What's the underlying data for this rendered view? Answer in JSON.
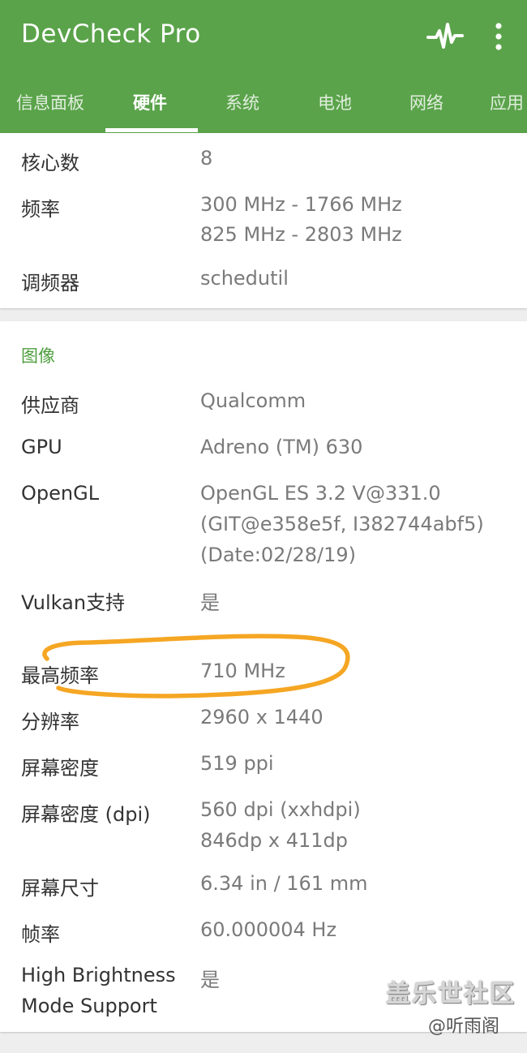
{
  "header": {
    "app_title": "DevCheck Pro",
    "pulse_icon": "pulse-icon",
    "menu_icon": "more-vert-icon",
    "colors": {
      "bar": "#5aa34a",
      "accent": "#4e9e3e"
    }
  },
  "tabs": [
    {
      "label": "信息面板"
    },
    {
      "label": "硬件"
    },
    {
      "label": "系统"
    },
    {
      "label": "电池"
    },
    {
      "label": "网络"
    },
    {
      "label": "应用"
    }
  ],
  "active_tab": "硬件",
  "cpu": {
    "cores_label": "核心数",
    "cores_value": "8",
    "freq_label": "频率",
    "freq_values": [
      "300 MHz - 1766 MHz",
      "825 MHz - 2803 MHz"
    ],
    "governor_label": "调频器",
    "governor_value": "schedutil"
  },
  "graphics": {
    "title": "图像",
    "rows": [
      {
        "label": "供应商",
        "lines": [
          "Qualcomm"
        ]
      },
      {
        "label": "GPU",
        "lines": [
          "Adreno (TM) 630"
        ]
      },
      {
        "label": "OpenGL",
        "lines": [
          "OpenGL ES 3.2 V@331.0",
          "(GIT@e358e5f, I382744abf5)",
          "(Date:02/28/19)"
        ]
      },
      {
        "label": "Vulkan支持",
        "lines": [
          "是"
        ]
      },
      {
        "label": "最高频率",
        "lines": [
          "710 MHz"
        ]
      },
      {
        "label": "分辨率",
        "lines": [
          "2960 x 1440"
        ]
      },
      {
        "label": "屏幕密度",
        "lines": [
          "519 ppi"
        ]
      },
      {
        "label": "屏幕密度 (dpi)",
        "lines": [
          "560 dpi (xxhdpi)",
          "846dp x 411dp"
        ]
      },
      {
        "label": "屏幕尺寸",
        "lines": [
          "6.34 in / 161 mm"
        ]
      },
      {
        "label": "帧率",
        "lines": [
          "60.000004 Hz"
        ]
      },
      {
        "label_lines": [
          "High Brightness",
          "Mode Support"
        ],
        "lines": [
          "是"
        ]
      }
    ]
  },
  "annotation": {
    "color": "#f5a623"
  },
  "watermark": {
    "line1": "盖乐世社区",
    "line2": "@听雨阁"
  }
}
